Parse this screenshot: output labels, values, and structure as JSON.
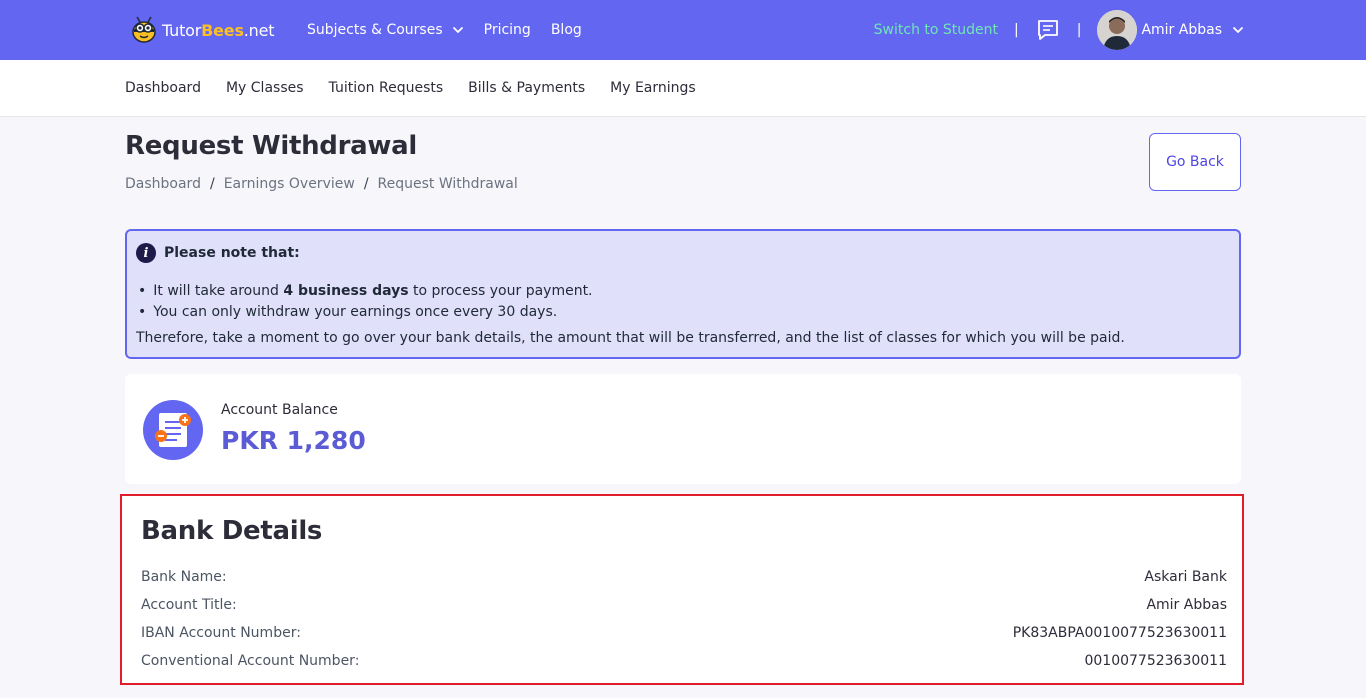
{
  "brand": {
    "name_prefix": "Tutor",
    "name_accent": "Bees",
    "name_suffix": ".net"
  },
  "nav": {
    "items": [
      {
        "label": "Subjects & Courses",
        "has_dropdown": true
      },
      {
        "label": "Pricing"
      },
      {
        "label": "Blog"
      }
    ],
    "switch_label": "Switch to Student",
    "separator": "|",
    "user_name": "Amir Abbas"
  },
  "subnav": {
    "items": [
      "Dashboard",
      "My Classes",
      "Tuition Requests",
      "Bills & Payments",
      "My Earnings"
    ]
  },
  "page": {
    "title": "Request Withdrawal",
    "breadcrumb": [
      "Dashboard",
      "Earnings Overview",
      "Request Withdrawal"
    ],
    "breadcrumb_separator": "/",
    "go_back_label": "Go Back"
  },
  "note": {
    "title": "Please note that:",
    "item1_prefix": "It will take around ",
    "item1_bold": "4 business days",
    "item1_suffix": " to process your payment.",
    "item2": "You can only withdraw your earnings once every 30 days.",
    "footer": "Therefore, take a moment to go over your bank details, the amount that will be transferred, and the list of classes for which you will be paid."
  },
  "balance": {
    "label": "Account Balance",
    "value": "PKR 1,280"
  },
  "bank": {
    "title": "Bank Details",
    "rows": [
      {
        "label": "Bank Name:",
        "value": "Askari Bank"
      },
      {
        "label": "Account Title:",
        "value": "Amir Abbas"
      },
      {
        "label": "IBAN Account Number:",
        "value": "PK83ABPA0010077523630011"
      },
      {
        "label": "Conventional Account Number:",
        "value": "0010077523630011"
      }
    ]
  },
  "colors": {
    "primary": "#6366f1",
    "switch_link": "#6ee7b7",
    "highlight_border": "#e11d2b",
    "balance_value": "#5b5bd6"
  }
}
